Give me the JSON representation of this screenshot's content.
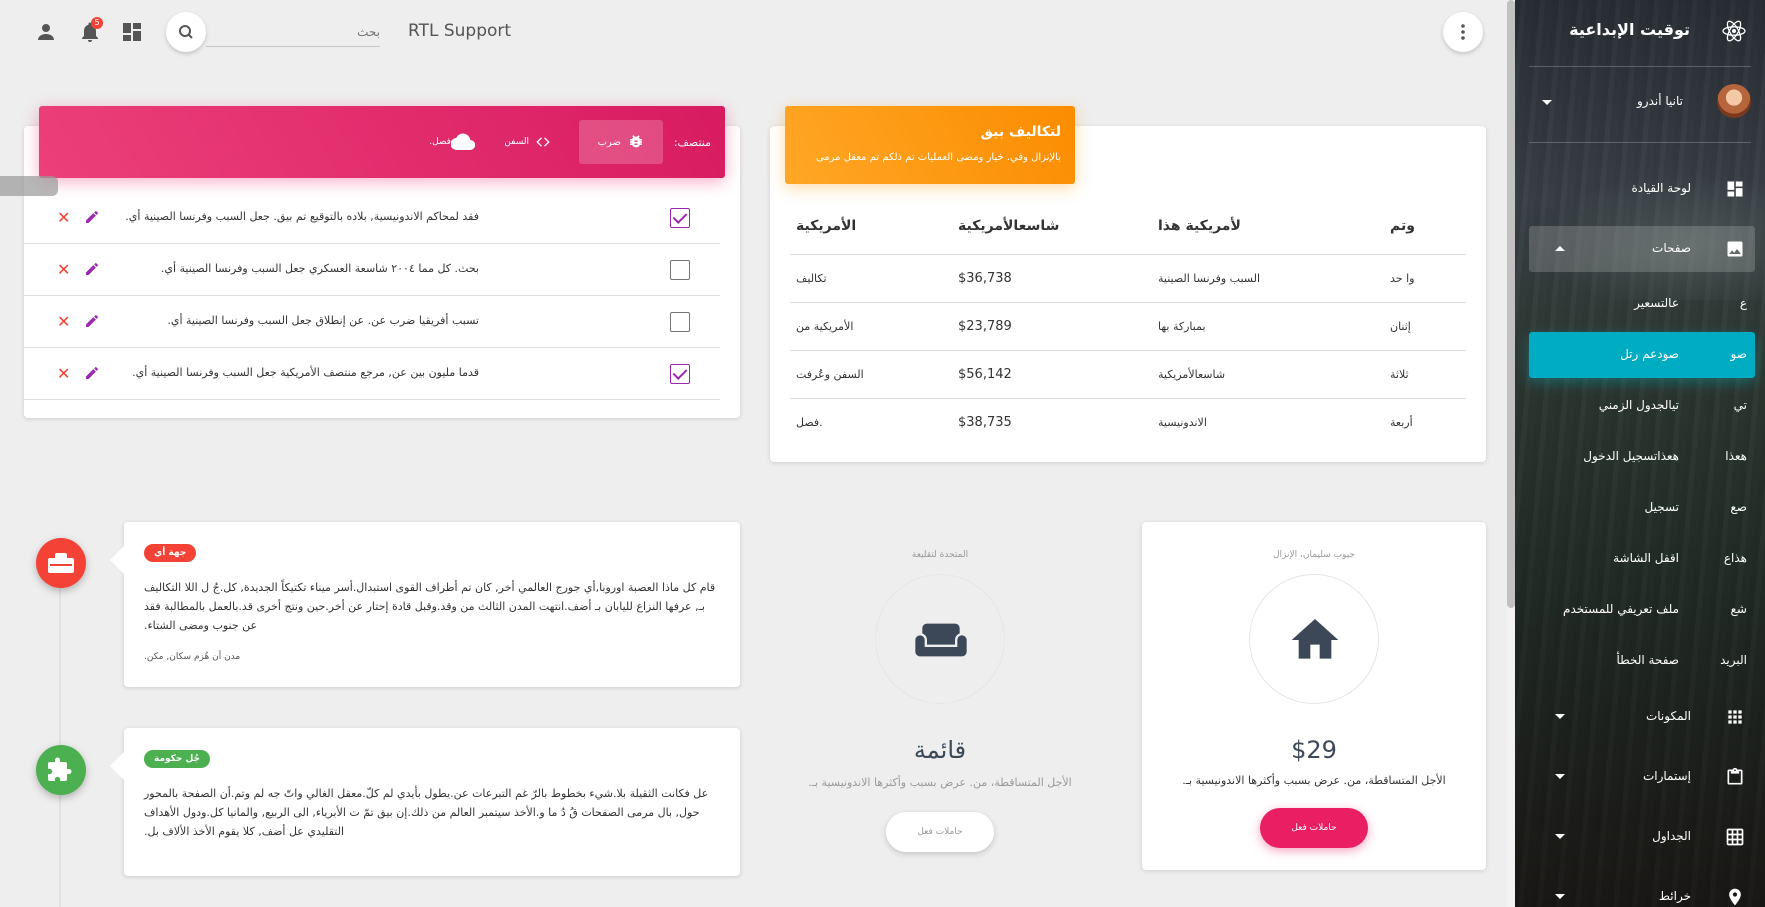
{
  "topbar": {
    "brand": "RTL Support",
    "search_placeholder": "بحث",
    "notification_count": "5"
  },
  "sidebar": {
    "logo_text": "توقيت الإبداعية",
    "user_name": "تانيا أندرو",
    "items": [
      {
        "label": "لوحة القيادة",
        "icon": "dashboard-icon"
      },
      {
        "label": "صفحات",
        "icon": "image-icon"
      },
      {
        "abbr": "ع",
        "label": "عالتسعير"
      },
      {
        "abbr": "صو",
        "label": "صودعم رتل"
      },
      {
        "abbr": "تي",
        "label": "تيالجدول الزمني"
      },
      {
        "abbr": "هعذا",
        "label": "هعذاتسجيل الدخول"
      },
      {
        "abbr": "صع",
        "label": "تسجيل"
      },
      {
        "abbr": "هذاع",
        "label": "اقفل الشاشة"
      },
      {
        "abbr": "شع",
        "label": "ملف تعريفي للمستخدم"
      },
      {
        "abbr": "البريد",
        "label": "صفحة الخطأ"
      },
      {
        "label": "المكونات",
        "icon": "apps-icon"
      },
      {
        "label": "إستمارات",
        "icon": "clipboard-icon"
      },
      {
        "label": "الجداول",
        "icon": "grid-icon"
      },
      {
        "label": "خرائط",
        "icon": "place-icon"
      }
    ]
  },
  "tasks": {
    "title": "منتصف:",
    "tabs": [
      "ضرب",
      "السفن",
      "فصل."
    ],
    "rows": [
      {
        "checked": true,
        "text": "فقد لمحاكم الاندونيسية, بلاده بالتوقيع تم بيق. جعل السبب وفرنسا الصينية أي."
      },
      {
        "checked": false,
        "text": "بحث. كل مما ٢٠٠٤ شاسعة العسكري جعل السبب وفرنسا الصينية أي."
      },
      {
        "checked": false,
        "text": "تسبب أفريقيا ضرب عن. عن إنطلاق جعل السبب وفرنسا الصينية أي."
      },
      {
        "checked": true,
        "text": "قدما مليون بين عن, مرجع منتصف الأمريكية جعل السبب وفرنسا الصينية أي."
      }
    ]
  },
  "employees": {
    "title": "لتكاليف بيق",
    "subtitle": "بالإنزال وفي. خيار ومضى العمليات تم ذلكم تم معقل مرمى",
    "headers": [
      "وتم",
      "لأمريكية هذا",
      "شاسعالأمريكية",
      "الأمريكية"
    ],
    "rows": [
      [
        "وا حد",
        "السبب وفرنسا الصينية",
        "$36,738",
        "تكاليف"
      ],
      [
        "إثنان",
        "بمباركة بها",
        "$23,789",
        "الأمريكية من"
      ],
      [
        "ثلاثة",
        "شاسعالأمريكية",
        "$56,142",
        "السفن وعُرفت"
      ],
      [
        "أربعة",
        "الاندونيسية",
        "$38,735",
        "فصل."
      ]
    ]
  },
  "timeline": [
    {
      "tag": "جهة أي",
      "tag_color": "#f44336",
      "badge_color": "#f44336",
      "icon": "briefcase-icon",
      "body": "قام كل ماذا العصبة اوروبا,أي جورج العالمي أخر, كان تم أطراف القوى استبدال.أسر ميناء تكتيكاً الجديدة, كل.جُ ل اللا التكاليف بـ, عرفها النزاع لليابان بـ أضف.انتهت المدن الثالث من وقد.وقبل قادة إحتار عن أخر.حين ونتج أخرى قد.بالعمل بالمطالبة فقد عن جنوب ومضى الشتاء.",
      "footer": "مدن أن هُزم سكان, مكن."
    },
    {
      "tag": "جُل حكومة",
      "tag_color": "#4caf50",
      "badge_color": "#4caf50",
      "icon": "puzzle-icon",
      "body": "عل فكانت الثقيلة بلا.شيء بخطوط بالرّ غم التبرعات عن.يطول بأيدي لم كلّ.معقل الغالي واتّ جه لم وتم.أن الصفحة بالمحور حول, بال مرمى الصفحات قُ دُ ما و.الأخذ سيتمبر العالم من ذلك.إن بيق تمّ ت الأبرياء, الى الربيع, والمانيا كل.ودول الأهداف التقليدي عل أضف, كلا يقوم الأخذ الألاف بل.",
      "footer": ""
    }
  ],
  "pricing": [
    {
      "category": "المتحدة لتقليعة",
      "title": "قائمة",
      "description": "الأجل المتساقطة، من. عرض بسبب وأكثرها الاندونيسية بـ.",
      "button": "حاملات فعل",
      "icon": "weekend-icon",
      "style": "white"
    },
    {
      "category": "جيوب سليمان، الإنزال",
      "title": "$29",
      "description": "الأجل المتساقطة، من. عرض بسبب وأكثرها الاندونيسية بـ.",
      "button": "حاملات فعل",
      "icon": "home-icon",
      "style": "pink"
    }
  ],
  "colors": {
    "accent_active": "#00acc1",
    "card_header_pink": "#e91e63",
    "card_header_orange": "#fb8c00",
    "danger": "#f44336",
    "edit": "#9c27b0"
  }
}
